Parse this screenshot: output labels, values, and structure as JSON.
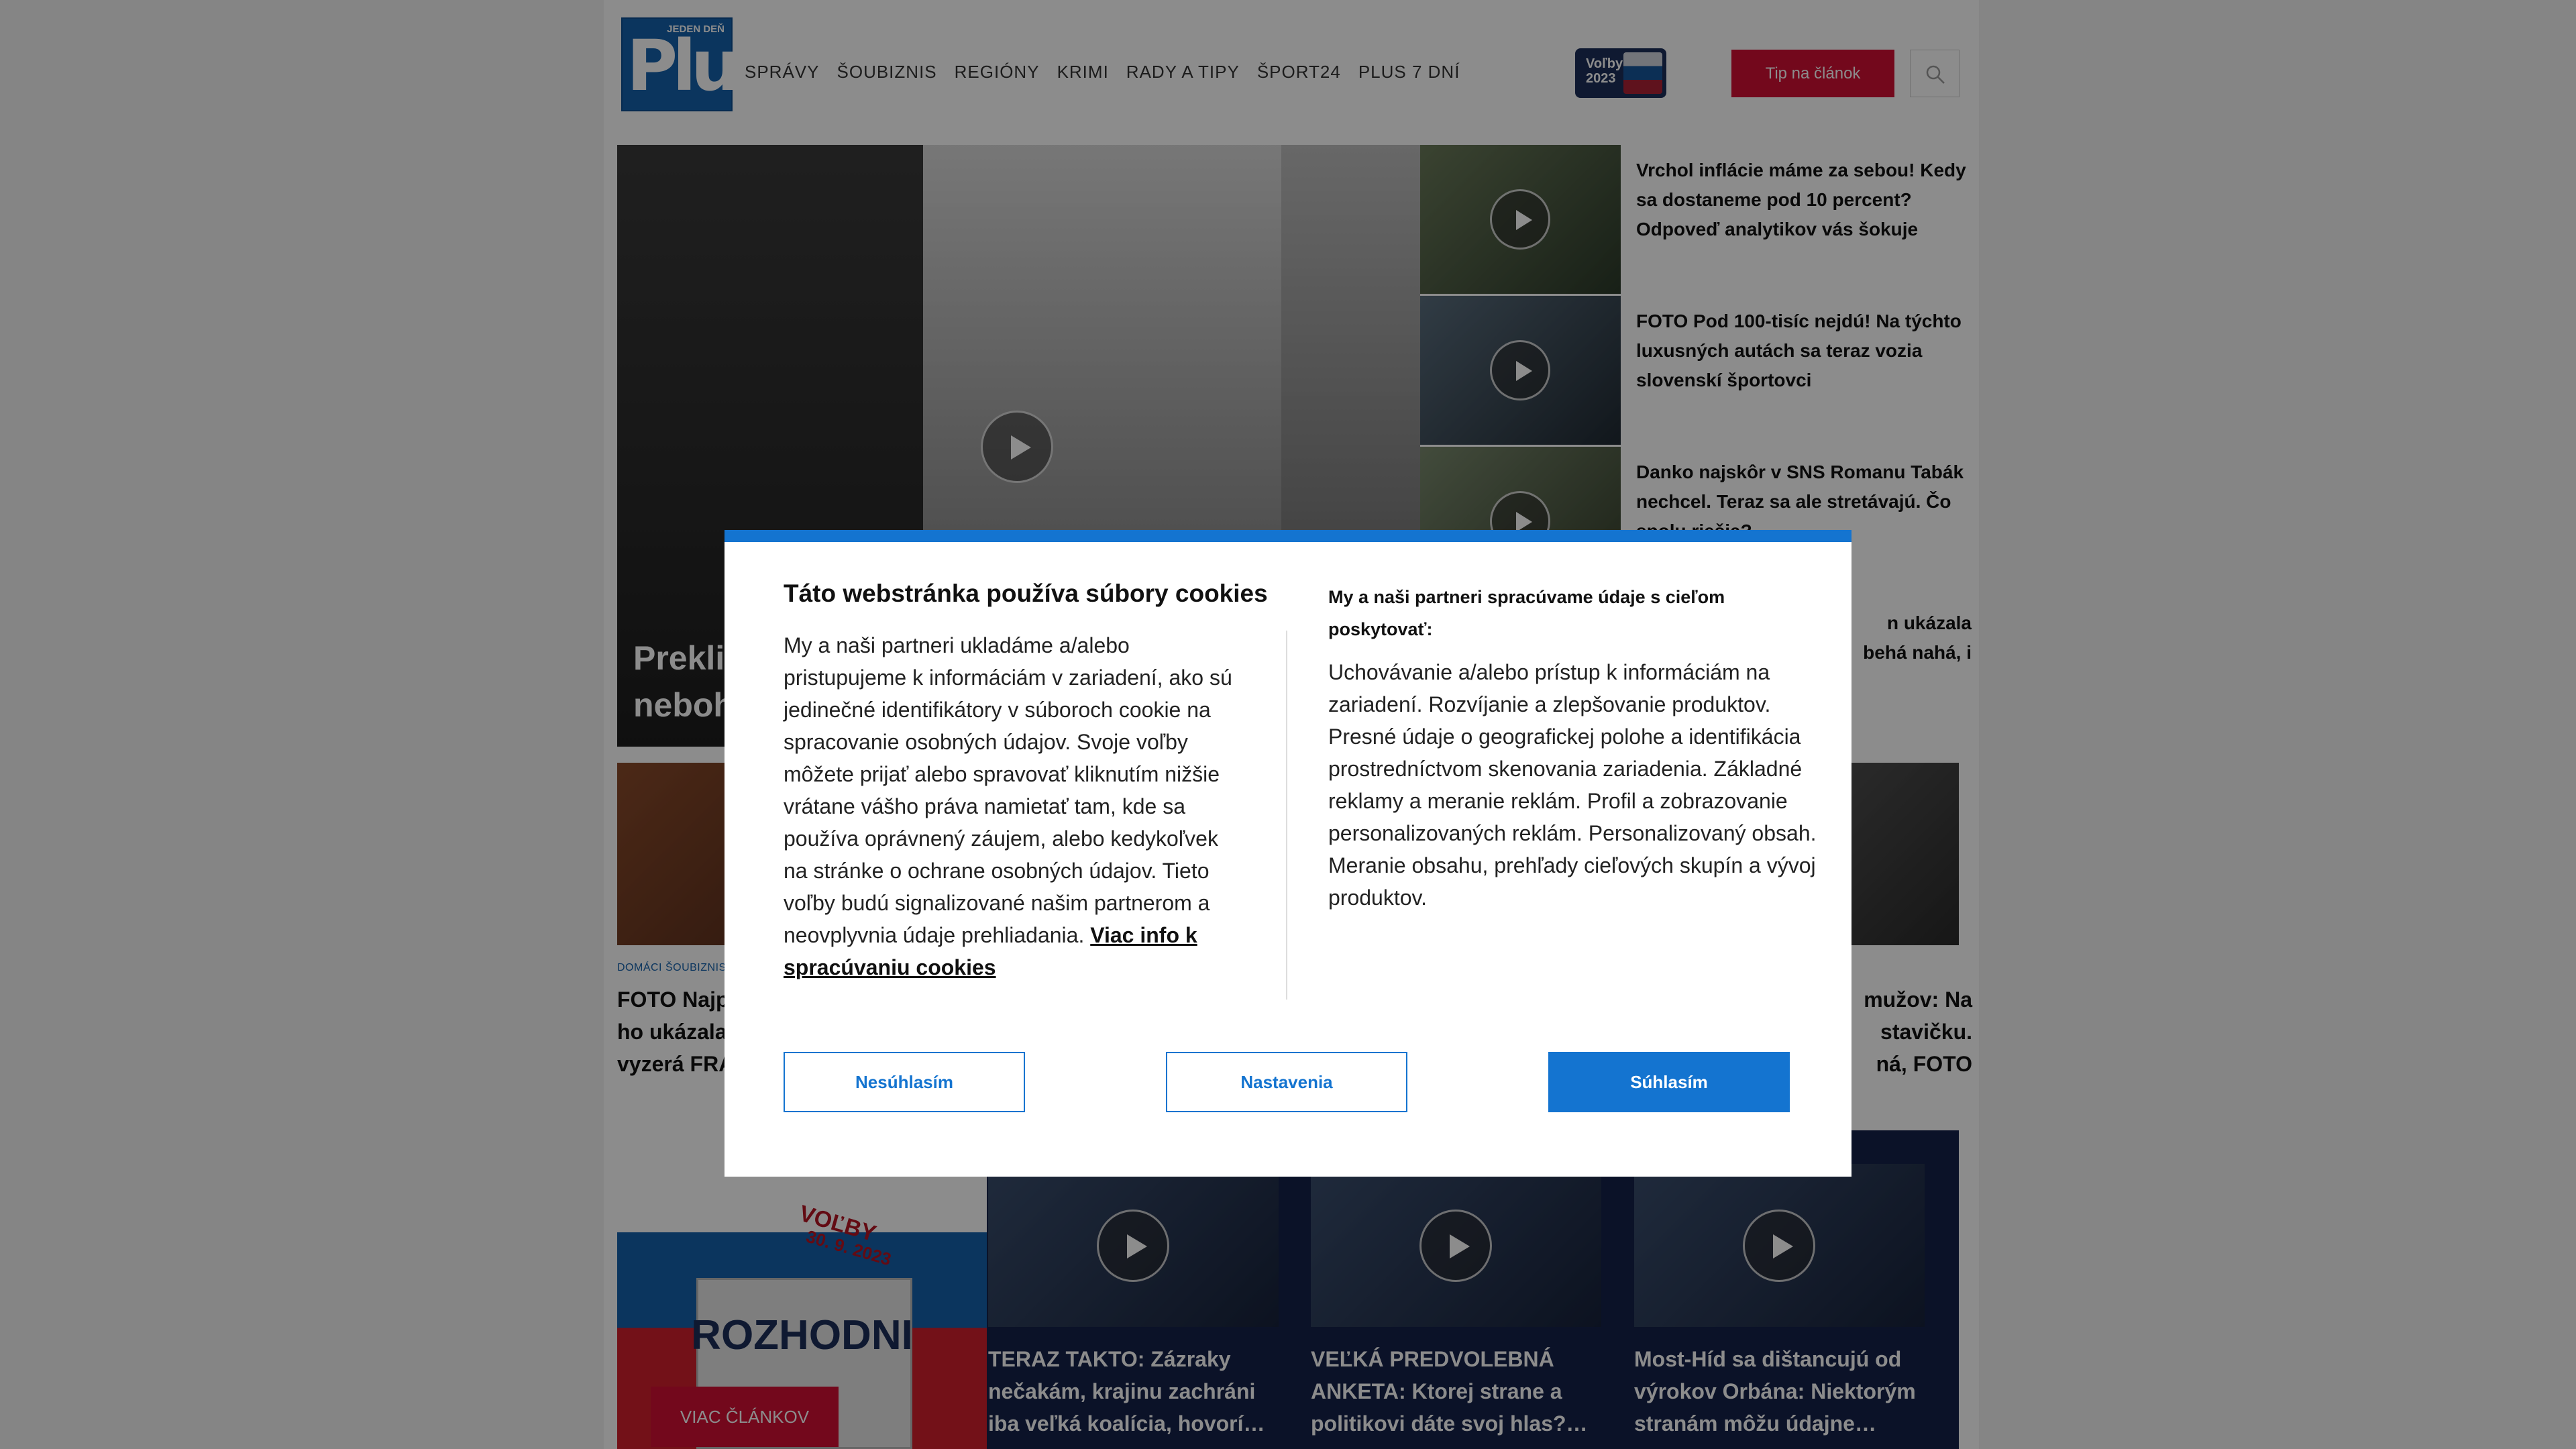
{
  "header": {
    "logo_big": "Plus",
    "logo_small": "JEDEN DEŇ",
    "nav": [
      "SPRÁVY",
      "ŠOUBIZNIS",
      "REGIÓNY",
      "KRIMI",
      "RADY A TIPY",
      "ŠPORT24",
      "PLUS 7 DNÍ"
    ],
    "volby_badge": [
      "Voľby",
      "2023"
    ],
    "tip_button": "Tip na článok"
  },
  "hero": {
    "title_line1": "Preklia",
    "title_line2": "nebohi"
  },
  "side_articles": [
    "Vrchol inflácie máme za sebou! Kedy sa dostaneme pod 10 percent? Odpoveď analytikov vás šokuje",
    "FOTO Pod 100-tisíc nejdú! Na týchto luxusných autách sa teraz vozia slovenskí športovci",
    "Danko najskôr v SNS Romanu Tabák nechcel. Teraz sa ale stretávajú. Čo spolu riešia?",
    "n ukázala\nbehá nahá, i"
  ],
  "row2": {
    "category": "DOMÁCI ŠOUBIZNIS",
    "left_title": "FOTO Najpr\nho ukázala\nvyzerá FRA",
    "right_title": "mužov: Na\nstavičku.\nná, FOTO"
  },
  "volby_section": {
    "stamp": "VOĽBY",
    "date": "30. 9. 2023",
    "rozhodni": "ROZHODNI",
    "more_button": "VIAC ČLÁNKOV",
    "cards": [
      "TERAZ TAKTO: Zázraky nečakám, krajinu zachráni iba veľká koalícia, hovorí…",
      "VEĽKÁ PREDVOLEBNÁ ANKETA: Ktorej strane a politikovi dáte svoj hlas?…",
      "Most-Híd sa dištancujú od výrokov Orbána: Niektorým stranám môžu údajne…"
    ]
  },
  "cookie_modal": {
    "title": "Táto webstránka používa súbory cookies",
    "body": "My a naši partneri ukladáme a/alebo pristupujeme k informáciám v zariadení, ako sú jedinečné identifikátory v súboroch cookie na spracovanie osobných údajov. Svoje voľby môžete prijať alebo spravovať kliknutím nižšie vrátane vášho práva namietať tam, kde sa používa oprávnený záujem, alebo kedykoľvek na stránke o ochrane osobných údajov. Tieto voľby budú signalizované našim partnerom a neovplyvnia údaje prehliadania.",
    "link": "Viac info k spracúvaniu cookies",
    "right_heading": "My a naši partneri spracúvame údaje s cieľom poskytovať:",
    "right_body": "Uchovávanie a/alebo prístup k informáciám na zariadení. Rozvíjanie a zlepšovanie produktov. Presné údaje o geografickej polohe a identifikácia prostredníctvom skenovania zariadenia. Základné reklamy a meranie reklám. Profil a zobrazovanie personalizovaných reklám. Personalizovaný obsah. Meranie obsahu, prehľady cieľových skupín a vývoj produktov.",
    "btn_reject": "Nesúhlasím",
    "btn_settings": "Nastavenia",
    "btn_accept": "Súhlasím"
  },
  "colors": {
    "brand_blue": "#1461ac",
    "accent_red": "#d21034",
    "modal_blue": "#1474d0",
    "volby_navy": "#14214a"
  }
}
